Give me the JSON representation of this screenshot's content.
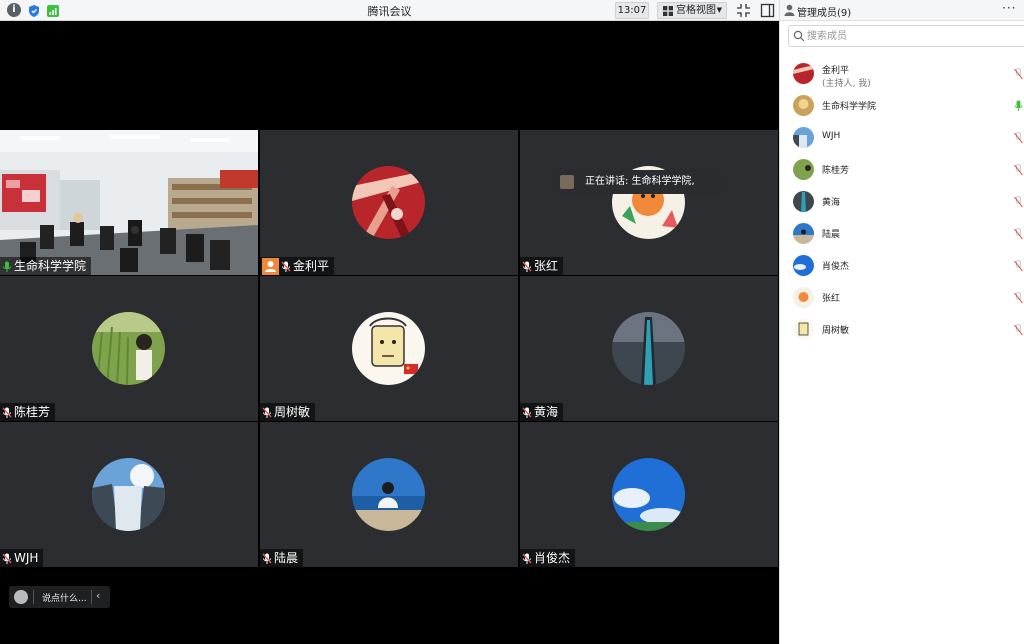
{
  "app": {
    "title": "腾讯会议",
    "time": "13:07",
    "view_label": "宫格视图"
  },
  "speaking": {
    "label": "正在讲话: 生命科学学院,"
  },
  "tiles": [
    {
      "name": "生命科学学院",
      "mic": "on",
      "host": false,
      "avatar": "classroom-video"
    },
    {
      "name": "金利平",
      "mic": "muted",
      "host": true,
      "avatar": "red-lights-avatar"
    },
    {
      "name": "张红",
      "mic": "muted",
      "host": false,
      "avatar": "cartoon-avatar"
    },
    {
      "name": "陈桂芳",
      "mic": "muted",
      "host": false,
      "avatar": "wheat-field-avatar"
    },
    {
      "name": "周树敏",
      "mic": "muted",
      "host": false,
      "avatar": "sketch-face-avatar"
    },
    {
      "name": "黄海",
      "mic": "muted",
      "host": false,
      "avatar": "tower-avatar"
    },
    {
      "name": "WJH",
      "mic": "muted",
      "host": false,
      "avatar": "waterfall-avatar"
    },
    {
      "name": "陆晨",
      "mic": "muted",
      "host": false,
      "avatar": "seaside-avatar"
    },
    {
      "name": "肖俊杰",
      "mic": "muted",
      "host": false,
      "avatar": "blue-sky-avatar"
    }
  ],
  "chat": {
    "placeholder": "说点什么..."
  },
  "panel": {
    "title": "管理成员(9)",
    "search_placeholder": "搜索成员",
    "members": [
      {
        "name": "金利平",
        "sub": "(主持人, 我)",
        "mic": "muted"
      },
      {
        "name": "生命科学学院",
        "sub": "",
        "mic": "on"
      },
      {
        "name": "WJH",
        "sub": "",
        "mic": "muted"
      },
      {
        "name": "陈桂芳",
        "sub": "",
        "mic": "muted"
      },
      {
        "name": "黄海",
        "sub": "",
        "mic": "muted"
      },
      {
        "name": "陆晨",
        "sub": "",
        "mic": "muted"
      },
      {
        "name": "肖俊杰",
        "sub": "",
        "mic": "muted"
      },
      {
        "name": "张红",
        "sub": "",
        "mic": "muted"
      },
      {
        "name": "周树敏",
        "sub": "",
        "mic": "muted"
      }
    ]
  },
  "colors": {
    "mic_on": "#3fbf3f",
    "mic_muted": "#e05a5a",
    "host_badge": "#f0883a"
  }
}
